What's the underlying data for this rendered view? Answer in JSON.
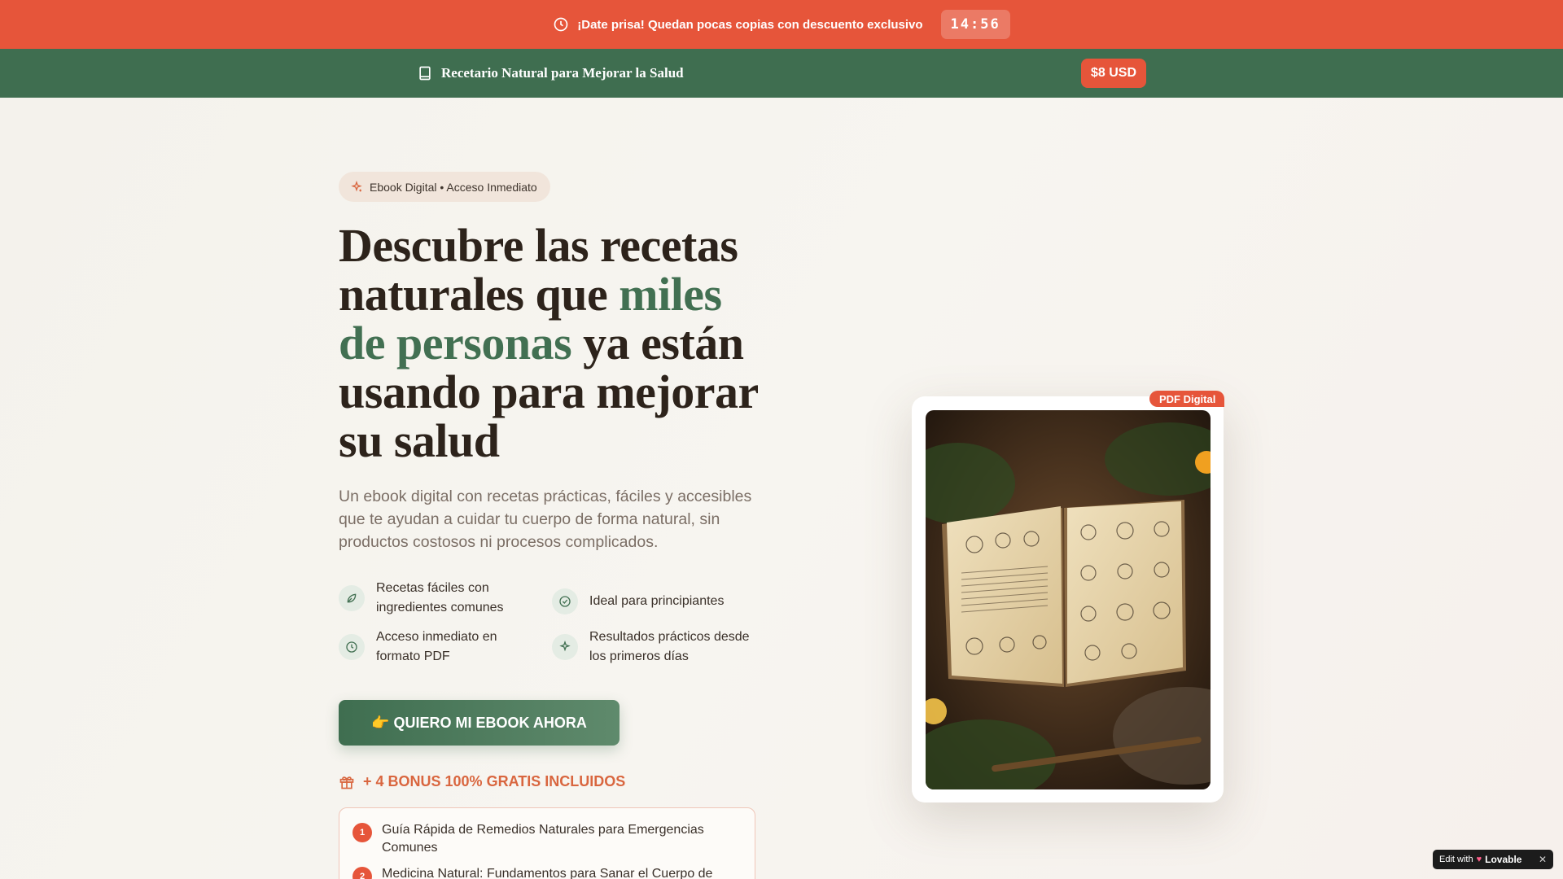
{
  "promo": {
    "text": "¡Date prisa! Quedan pocas copias con descuento exclusivo",
    "timer": "14:56",
    "icon": "clock-icon"
  },
  "nav": {
    "brand": "Recetario Natural para Mejorar la Salud",
    "brand_icon": "book-icon",
    "price": "$8 USD"
  },
  "hero": {
    "eyebrow": "Ebook Digital • Acceso Inmediato",
    "headline_part1": "Descubre las recetas naturales que ",
    "headline_highlight": "miles de personas",
    "headline_part2": " ya están usando para mejorar su salud",
    "subtitle": "Un ebook digital con recetas prácticas, fáciles y accesibles que te ayudan a cuidar tu cuerpo de forma natural, sin productos costosos ni procesos complicados.",
    "features": [
      {
        "text": "Recetas fáciles con ingredientes comunes",
        "icon": "leaf-icon"
      },
      {
        "text": "Ideal para principiantes",
        "icon": "check-circle-icon"
      },
      {
        "text": "Acceso inmediato en formato PDF",
        "icon": "clock-icon"
      },
      {
        "text": "Resultados prácticos desde los primeros días",
        "icon": "sparkles-icon"
      }
    ],
    "cta": "👉 QUIERO MI EBOOK AHORA",
    "bonus_heading": "+ 4 BONUS 100% GRATIS INCLUIDOS",
    "bonus_items": [
      {
        "num": "1",
        "text": "Guía Rápida de Remedios Naturales para Emergencias Comunes"
      },
      {
        "num": "2",
        "text": "Medicina Natural: Fundamentos para Sanar el Cuerpo de"
      }
    ]
  },
  "product": {
    "tag": "PDF Digital"
  },
  "badge": {
    "edit_with": "Edit with",
    "brand": "Lovable",
    "close": "✕"
  },
  "colors": {
    "promo_bg": "#e6553a",
    "nav_bg": "#3f6e50",
    "accent_green": "#427052",
    "accent_orange": "#e6553a"
  }
}
